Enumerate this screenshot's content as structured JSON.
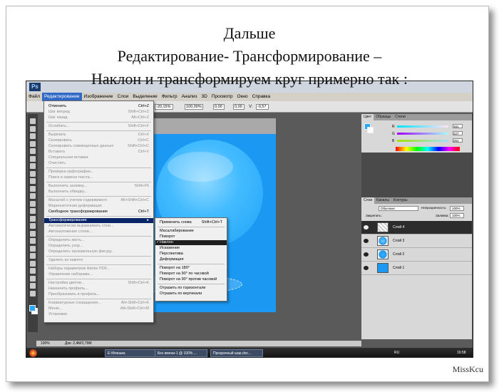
{
  "slide": {
    "title_line1": "Дальше",
    "title_line2": "Редактирование- Трансформирование –",
    "title_line3": "Наклон и трансформируем круг примерно так :",
    "credit": "MissKcu"
  },
  "app": {
    "logo": "Ps",
    "menubar": [
      "Файл",
      "Редактирование",
      "Изображение",
      "Слои",
      "Выделение",
      "Фильтр",
      "Анализ",
      "3D",
      "Просмотр",
      "Окно",
      "Справка"
    ],
    "options": {
      "w_value": "-20,15%",
      "h_value": "100,00%",
      "angle_value": "0,00",
      "h_skew_value": "0,00",
      "v_skew_label": "V:",
      "v_skew_value": "-0,57"
    }
  },
  "edit_menu": [
    {
      "label": "Отменить",
      "shortcut": "Ctrl+Z",
      "disabled": false
    },
    {
      "label": "Шаг вперед",
      "shortcut": "Shift+Ctrl+Z",
      "disabled": true
    },
    {
      "label": "Шаг назад",
      "shortcut": "Alt+Ctrl+Z",
      "disabled": true
    },
    {
      "label": "Ослабить...",
      "shortcut": "Shift+Ctrl+F",
      "disabled": true
    },
    {
      "label": "Вырезать",
      "shortcut": "Ctrl+X",
      "disabled": true
    },
    {
      "label": "Скопировать",
      "shortcut": "Ctrl+C",
      "disabled": true
    },
    {
      "label": "Скопировать совмещенные данные",
      "shortcut": "Shift+Ctrl+C",
      "disabled": true
    },
    {
      "label": "Вставить",
      "shortcut": "Ctrl+V",
      "disabled": true
    },
    {
      "label": "Специальная вставка",
      "shortcut": "",
      "disabled": true
    },
    {
      "label": "Очистить",
      "shortcut": "",
      "disabled": true
    },
    {
      "label": "Проверка орфографии...",
      "shortcut": "",
      "disabled": true
    },
    {
      "label": "Поиск и замена текста...",
      "shortcut": "",
      "disabled": true
    },
    {
      "label": "Выполнить заливку...",
      "shortcut": "Shift+F5",
      "disabled": true
    },
    {
      "label": "Выполнить обводку...",
      "shortcut": "",
      "disabled": true
    },
    {
      "label": "Масштаб с учетом содержимого",
      "shortcut": "Alt+Shift+Ctrl+C",
      "disabled": true
    },
    {
      "label": "Марионеточная деформация",
      "shortcut": "",
      "disabled": true
    },
    {
      "label": "Свободное трансформирование",
      "shortcut": "Ctrl+T",
      "disabled": false
    },
    {
      "label": "Трансформирование",
      "shortcut": "",
      "disabled": false,
      "highlighted": true
    },
    {
      "label": "Автоматически выравнивать слои...",
      "shortcut": "",
      "disabled": true
    },
    {
      "label": "Автоналожение слоев...",
      "shortcut": "",
      "disabled": true
    },
    {
      "label": "Определить кисть...",
      "shortcut": "",
      "disabled": true
    },
    {
      "label": "Определить узор...",
      "shortcut": "",
      "disabled": true
    },
    {
      "label": "Определить произвольную фигуру...",
      "shortcut": "",
      "disabled": true
    },
    {
      "label": "Удалить из памяти",
      "shortcut": "",
      "disabled": true
    },
    {
      "label": "Наборы параметров Adobe PDF...",
      "shortcut": "",
      "disabled": true
    },
    {
      "label": "Управление наборами...",
      "shortcut": "",
      "disabled": true
    },
    {
      "label": "Настройка цветов...",
      "shortcut": "Shift+Ctrl+K",
      "disabled": true
    },
    {
      "label": "Назначить профиль...",
      "shortcut": "",
      "disabled": true
    },
    {
      "label": "Преобразовать в профиль...",
      "shortcut": "",
      "disabled": true
    },
    {
      "label": "Клавиатурные сокращения...",
      "shortcut": "Alt+Shift+Ctrl+K",
      "disabled": true
    },
    {
      "label": "Меню...",
      "shortcut": "Alt+Shift+Ctrl+M",
      "disabled": true
    },
    {
      "label": "Установки",
      "shortcut": "",
      "disabled": true
    }
  ],
  "transform_menu": [
    {
      "label": "Применить снова",
      "shortcut": "Shift+Ctrl+T"
    },
    {
      "label": "Масштабирование",
      "shortcut": ""
    },
    {
      "label": "Поворот",
      "shortcut": ""
    },
    {
      "label": "Наклон",
      "shortcut": "",
      "checked": true
    },
    {
      "label": "Искажение",
      "shortcut": ""
    },
    {
      "label": "Перспектива",
      "shortcut": ""
    },
    {
      "label": "Деформация",
      "shortcut": ""
    },
    {
      "label": "Поворот на 180°",
      "shortcut": ""
    },
    {
      "label": "Поворот на 90° по часовой",
      "shortcut": ""
    },
    {
      "label": "Поворот на 90° против часовой",
      "shortcut": ""
    },
    {
      "label": "Отразить по горизонтали",
      "shortcut": ""
    },
    {
      "label": "Отразить по вертикали",
      "shortcut": ""
    }
  ],
  "color_panel": {
    "tabs": [
      "Цвет",
      "Образцы",
      "Стили"
    ],
    "r_label": "R",
    "g_label": "G",
    "b_label": "B",
    "r_value": "161",
    "g_value": "227",
    "b_value": "251"
  },
  "layers_panel": {
    "tabs": [
      "Слои",
      "Каналы",
      "Контуры"
    ],
    "blend_mode": "Обычные",
    "opacity_label": "Непрозрачность:",
    "opacity_value": "100%",
    "lock_label": "Закрепить:",
    "fill_label": "Заливка:",
    "fill_value": "100%",
    "layers": [
      {
        "name": "Слой 4",
        "active": true
      },
      {
        "name": "Слой 3",
        "active": false
      },
      {
        "name": "Слой 2",
        "active": false
      },
      {
        "name": "Слой 1",
        "active": false
      }
    ]
  },
  "status": {
    "zoom": "100%",
    "doc_info": "Док: 2,4М/2,79М"
  },
  "taskbar": {
    "items": [
      "E:\\Флешка",
      "Без имени-1 @ 100% ...",
      "Прозрачный шар.doc..."
    ],
    "lang": "RU",
    "time": "16:58"
  },
  "colors": {
    "canvas_blue": "#1a98f2",
    "menu_highlight": "#0a246a",
    "fg_swatch": "#29a8ff",
    "bg_swatch": "#ffffff"
  }
}
